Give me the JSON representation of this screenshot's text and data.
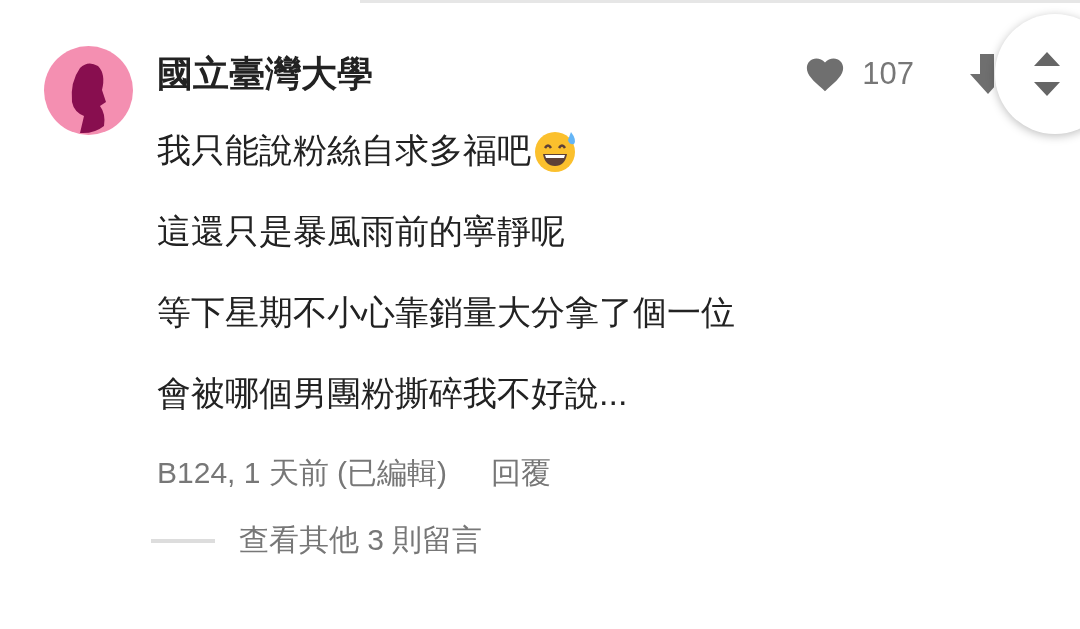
{
  "comment": {
    "author": "國立臺灣大學",
    "likes": "107",
    "lines": [
      "我只能說粉絲自求多福吧",
      "這還只是暴風雨前的寧靜呢",
      "等下星期不小心靠銷量大分拿了個一位",
      "會被哪個男團粉撕碎我不好說..."
    ],
    "meta": "B124, 1 天前 (已編輯)",
    "reply": "回覆",
    "more_replies": "查看其他 3 則留言"
  }
}
